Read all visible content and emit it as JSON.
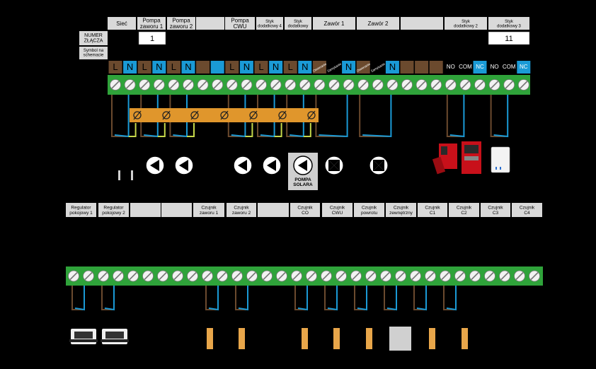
{
  "colors": {
    "background": "#000000",
    "header_box": "#d9d9d9",
    "strip_green": "#2fa33a",
    "terminal_white": "#f2f2f2",
    "wire_brown": "#6b4a2e",
    "wire_blue": "#1a9ad6",
    "wire_yellow_green": "#c6d84a",
    "bus_orange": "#e0962c",
    "sym_brown": "#6b4a2e",
    "sym_blue": "#1a9ad6",
    "sensor_orange": "#e8a64a"
  },
  "top_labels": [
    {
      "text": "Sieć"
    },
    {
      "text": "Pompa\nzaworu 1"
    },
    {
      "text": "Pompa\nzaworu 2"
    },
    {
      "text": ""
    },
    {
      "text": "Pompa\nCWU"
    },
    {
      "text": "Styk\ndodatkowy 4"
    },
    {
      "text": "Styk\ndodatkowy"
    },
    {
      "text": "Zawór 1"
    },
    {
      "text": "Zawór 2"
    },
    {
      "text": ""
    },
    {
      "text": "Styk\ndodatkowy 2"
    },
    {
      "text": "Styk\ndodatkowy 3"
    }
  ],
  "legend": {
    "numer_label": "NUMER\nZŁĄCZA",
    "symbol_label": "Symbol na\nschemacie",
    "first_number": "1",
    "last_number": "11"
  },
  "symbols": [
    "L",
    "N",
    "L",
    "N",
    "L",
    "N",
    "",
    "",
    "L",
    "N",
    "L",
    "N",
    "L",
    "N",
    "Otwieranie",
    "Zamykanie",
    "N",
    "Otwieranie",
    "Zamykanie",
    "N",
    "",
    "",
    "",
    "NO",
    "COM",
    "NC",
    "NO",
    "COM",
    "NC"
  ],
  "pump_label": "POMPA\nSOLARA",
  "bottom_labels": [
    {
      "text": "Regulator\npokojowy 1"
    },
    {
      "text": "Regulator\npokojowy 2"
    },
    {
      "text": ""
    },
    {
      "text": ""
    },
    {
      "text": "Czujnik\nzaworu 1"
    },
    {
      "text": "Czujnik\nzaworu 2"
    },
    {
      "text": ""
    },
    {
      "text": "Czujnik\nCO"
    },
    {
      "text": "Czujnik\nCWU"
    },
    {
      "text": "Czujnik\npowrotu"
    },
    {
      "text": "Czujnik\nzewnętrzny"
    },
    {
      "text": "Czujnik\nC1"
    },
    {
      "text": "Czujnik\nC2"
    },
    {
      "text": "Czujnik\nC3"
    },
    {
      "text": "Czujnik\nC4"
    }
  ]
}
